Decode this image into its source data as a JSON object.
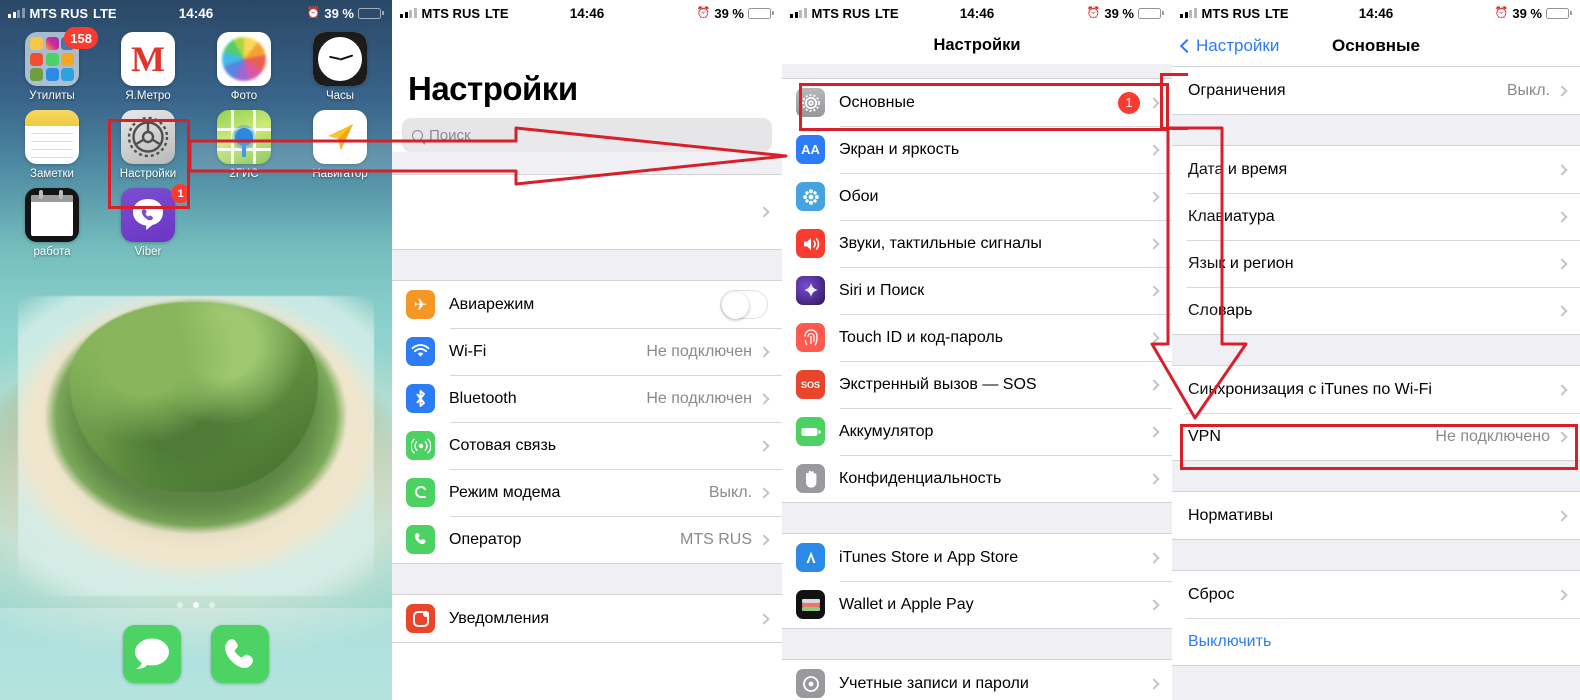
{
  "status_bar": {
    "carrier": "MTS RUS",
    "network": "LTE",
    "time": "14:46",
    "battery_percent": "39 %",
    "alarm_icon": "alarm-clock-icon"
  },
  "home_screen": {
    "apps": [
      {
        "label": "Утилиты",
        "icon": "folder-icon",
        "badge": "158"
      },
      {
        "label": "Я.Метро",
        "icon": "yandex-metro-icon",
        "badge": ""
      },
      {
        "label": "Фото",
        "icon": "photos-icon",
        "badge": ""
      },
      {
        "label": "Часы",
        "icon": "clock-icon",
        "badge": ""
      },
      {
        "label": "Заметки",
        "icon": "notes-icon",
        "badge": ""
      },
      {
        "label": "Настройки",
        "icon": "settings-gear-icon",
        "badge": ""
      },
      {
        "label": "2ГИС",
        "icon": "2gis-map-icon",
        "badge": ""
      },
      {
        "label": "Навигатор",
        "icon": "navigator-arrow-icon",
        "badge": ""
      },
      {
        "label": "работа",
        "icon": "work-calendar-icon",
        "badge": ""
      },
      {
        "label": "Viber",
        "icon": "viber-icon",
        "badge": "1"
      }
    ],
    "dock": [
      {
        "label": "Сообщения",
        "icon": "messages-icon"
      },
      {
        "label": "Телефон",
        "icon": "phone-icon"
      }
    ],
    "page_dots": 3,
    "active_page": 2
  },
  "settings_main": {
    "title": "Настройки",
    "search_placeholder": "Поиск",
    "apple_id_row": "",
    "rows": [
      {
        "label": "Авиарежим",
        "value": "",
        "icon": "airplane-icon",
        "control": "toggle"
      },
      {
        "label": "Wi-Fi",
        "value": "Не подключен",
        "icon": "wifi-icon",
        "control": "chevron"
      },
      {
        "label": "Bluetooth",
        "value": "Не подключен",
        "icon": "bluetooth-icon",
        "control": "chevron"
      },
      {
        "label": "Сотовая связь",
        "value": "",
        "icon": "cellular-icon",
        "control": "chevron"
      },
      {
        "label": "Режим модема",
        "value": "Выкл.",
        "icon": "hotspot-icon",
        "control": "chevron"
      },
      {
        "label": "Оператор",
        "value": "MTS RUS",
        "icon": "phone-icon",
        "control": "chevron"
      },
      {
        "label": "Уведомления",
        "value": "",
        "icon": "notifications-icon",
        "control": "chevron"
      }
    ]
  },
  "settings_list": {
    "title": "Настройки",
    "group1": [
      {
        "label": "Основные",
        "value": "",
        "icon": "gear-icon",
        "badge": "1",
        "highlight": true
      },
      {
        "label": "Экран и яркость",
        "value": "",
        "icon": "display-aa-icon",
        "badge": ""
      },
      {
        "label": "Обои",
        "value": "",
        "icon": "wallpaper-icon",
        "badge": ""
      },
      {
        "label": "Звуки, тактильные сигналы",
        "value": "",
        "icon": "sounds-icon",
        "badge": ""
      },
      {
        "label": "Siri и Поиск",
        "value": "",
        "icon": "siri-icon",
        "badge": ""
      },
      {
        "label": "Touch ID и код-пароль",
        "value": "",
        "icon": "touch-id-icon",
        "badge": ""
      },
      {
        "label": "Экстренный вызов — SOS",
        "value": "",
        "icon": "sos-icon",
        "badge": ""
      },
      {
        "label": "Аккумулятор",
        "value": "",
        "icon": "battery-icon",
        "badge": ""
      },
      {
        "label": "Конфиденциальность",
        "value": "",
        "icon": "privacy-hand-icon",
        "badge": ""
      }
    ],
    "group2": [
      {
        "label": "iTunes Store и App Store",
        "value": "",
        "icon": "app-store-icon"
      },
      {
        "label": "Wallet и Apple Pay",
        "value": "",
        "icon": "wallet-icon"
      }
    ],
    "group3": [
      {
        "label": "Учетные записи и пароли",
        "value": "",
        "icon": "accounts-icon"
      }
    ]
  },
  "general_screen": {
    "back_label": "Настройки",
    "title": "Основные",
    "group1": [
      {
        "label": "Ограничения",
        "value": "Выкл."
      }
    ],
    "group2": [
      {
        "label": "Дата и время",
        "value": ""
      },
      {
        "label": "Клавиатура",
        "value": ""
      },
      {
        "label": "Язык и регион",
        "value": ""
      },
      {
        "label": "Словарь",
        "value": ""
      }
    ],
    "group3": [
      {
        "label": "Синхронизация с iTunes по Wi-Fi",
        "value": ""
      },
      {
        "label": "VPN",
        "value": "Не подключено",
        "highlight": true
      }
    ],
    "group4": [
      {
        "label": "Нормативы",
        "value": ""
      }
    ],
    "group5": [
      {
        "label": "Сброс",
        "value": ""
      },
      {
        "label": "Выключить",
        "value": "",
        "blue": true
      }
    ]
  },
  "annotations": {
    "color": "#d91f2a",
    "box_settings_app": "Настройки app icon highlighted on home screen",
    "box_osnovnye": "Основные row highlighted in Settings list",
    "box_vpn": "VPN row highlighted in General screen",
    "arrow_1": "arrow from Настройки app icon to Settings list",
    "arrow_2": "arrow from Основные row down to VPN row"
  }
}
